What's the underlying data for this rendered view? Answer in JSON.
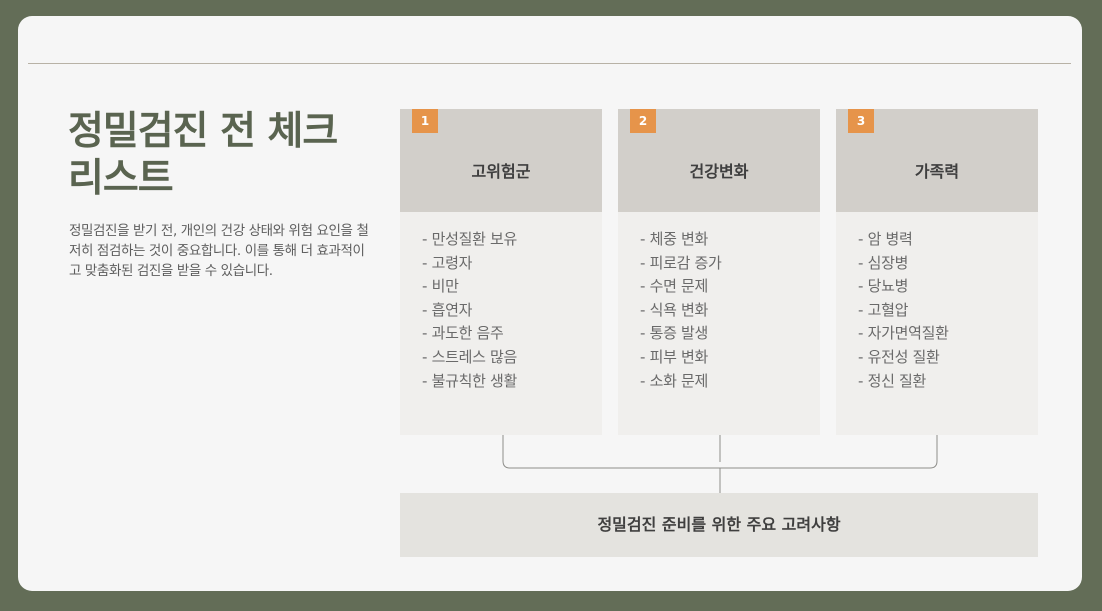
{
  "title": "정밀검진 전 체크리스트",
  "description": "정밀검진을 받기 전, 개인의 건강 상태와 위험 요인을 철저히 점검하는 것이 중요합니다. 이를 통해 더 효과적이고 맞춤화된 검진을 받을 수 있습니다.",
  "columns": [
    {
      "number": "1",
      "title": "고위험군",
      "items": [
        "만성질환 보유",
        "고령자",
        "비만",
        "흡연자",
        "과도한 음주",
        "스트레스 많음",
        "불규칙한 생활"
      ]
    },
    {
      "number": "2",
      "title": "건강변화",
      "items": [
        "체중 변화",
        "피로감 증가",
        "수면 문제",
        "식욕 변화",
        "통증 발생",
        "피부 변화",
        "소화 문제"
      ]
    },
    {
      "number": "3",
      "title": "가족력",
      "items": [
        "암 병력",
        "심장병",
        "당뇨병",
        "고혈압",
        "자가면역질환",
        "유전성 질환",
        "정신 질환"
      ]
    }
  ],
  "summary": "정밀검진 준비를 위한 주요 고려사항",
  "colors": {
    "accent": "#e6944a",
    "title": "#5a6450",
    "background": "#636d57"
  }
}
